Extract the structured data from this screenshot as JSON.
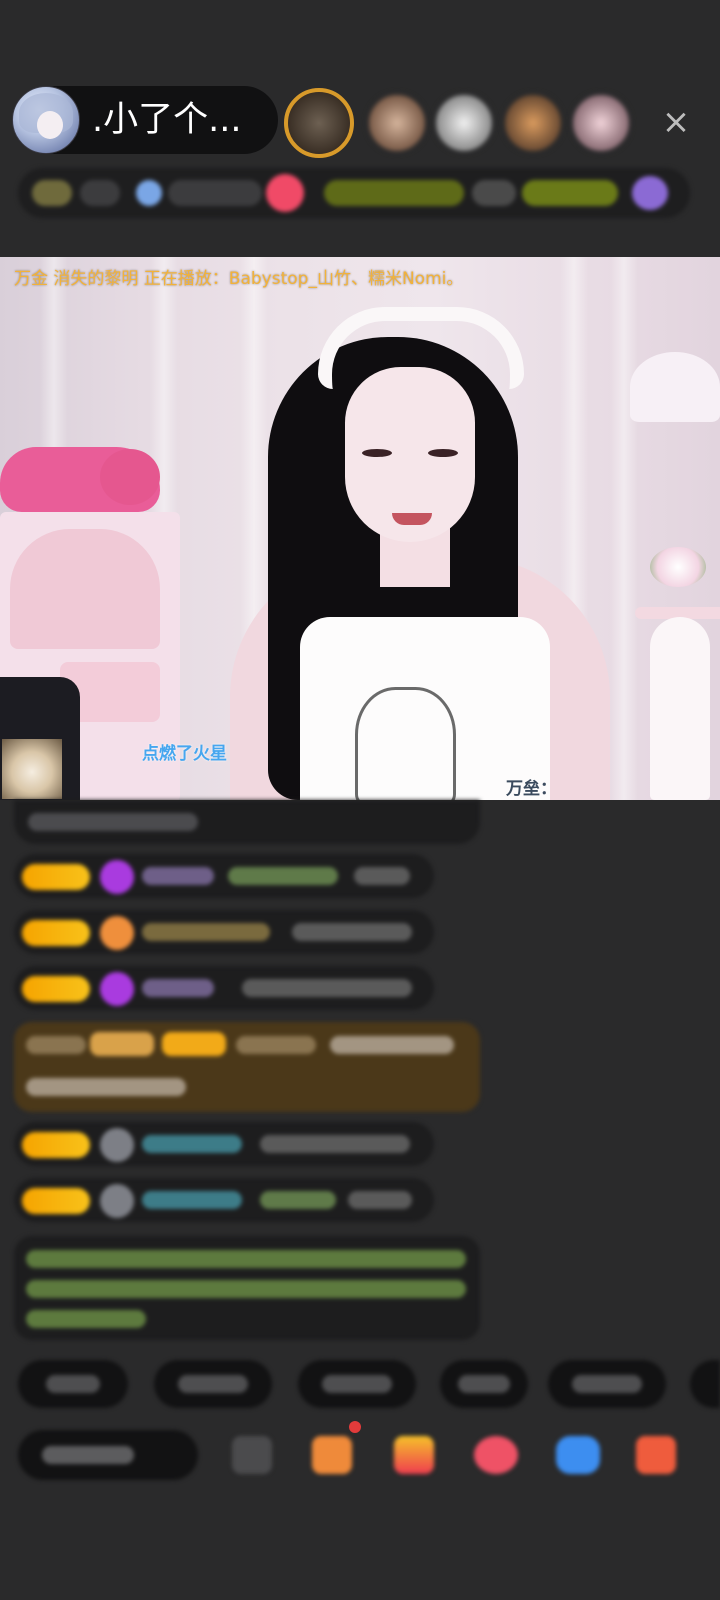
{
  "header": {
    "anchor_name": ".小了个...",
    "close_icon": "×"
  },
  "video": {
    "marquee": "万金 消失的黎明 正在播放：Babystop_山竹、糯米Nomi。",
    "danmaku": [
      {
        "text": "点燃了火星",
        "color": "#46a6ef"
      },
      {
        "text": "万垒："
      }
    ]
  },
  "colors": {
    "background": "#2a2a2b",
    "badge_gold": "#f6a400",
    "marquee": "#f2b23a",
    "special_message": "#4b3819"
  }
}
